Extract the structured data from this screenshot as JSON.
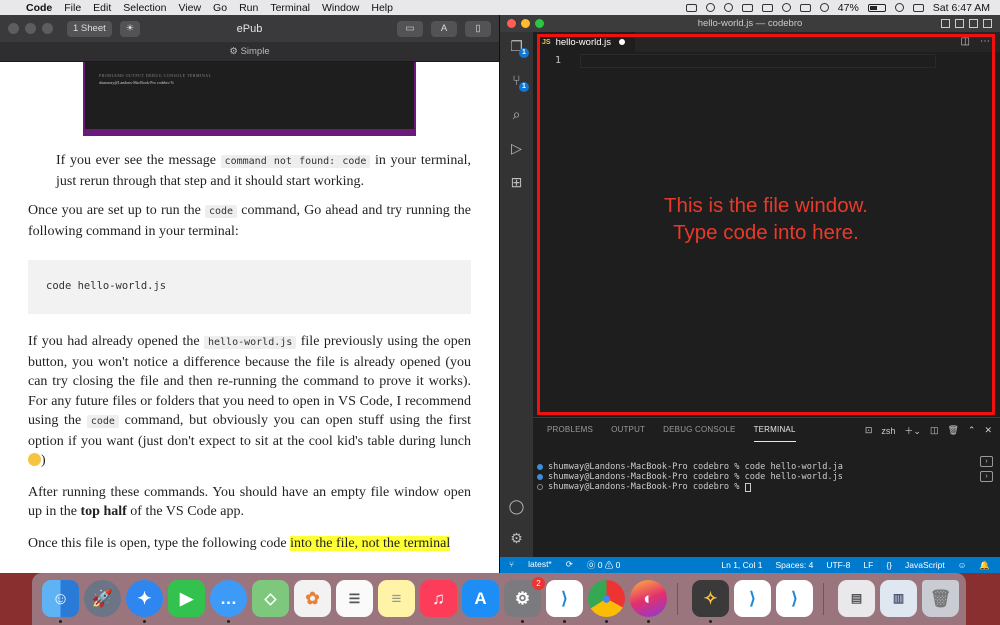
{
  "menubar": {
    "app_name": "Code",
    "items": [
      "File",
      "Edit",
      "Selection",
      "View",
      "Go",
      "Run",
      "Terminal",
      "Window",
      "Help"
    ],
    "battery": "47%",
    "battery_level": 0.47,
    "clock": "Sat 6:47 AM"
  },
  "epub": {
    "sheet_button": "1 Sheet",
    "window_title": "ePub",
    "theme_label": "Simple",
    "thumbnail": {
      "tabs": "PROBLEMS  OUTPUT  DEBUG CONSOLE  TERMINAL",
      "line": "shumway@Landons-MacBook-Pro codebro %"
    },
    "p1_pre": "If you ever see the message ",
    "p1_code": "command not found: code",
    "p1_post": " in your terminal, just rerun through that step and it should start working.",
    "p2_pre": "Once you are set up to run the ",
    "p2_code": "code",
    "p2_post": " command, Go ahead and try running the following command in your terminal:",
    "code_block": "code hello-world.js",
    "p3_a": "If you had already opened the ",
    "p3_code1": "hello-world.js",
    "p3_b": " file previously using the open button, you won't notice a difference because the file is already opened (you can try closing the file and then re-running the command to prove it works). For any future files or folders that you need to open in VS Code, I recommend using the ",
    "p3_code2": "code",
    "p3_c": " command, but obviously you can open stuff using the first option if you want (just don't expect to sit at the cool kid's table during lunch ",
    "p3_d": ")",
    "p4_pre": "After running these commands. You should have an empty file window open up in the ",
    "p4_bold": "top half",
    "p4_post": " of the VS Code app.",
    "p5_pre": "Once this file is open, type the following code ",
    "p5_hl": "into the file, not the terminal"
  },
  "vscode": {
    "window_title": "hello-world.js — codebro",
    "tab": {
      "icon_text": "JS",
      "label": "hello-world.js"
    },
    "line_number": "1",
    "annotation_line1": "This is the file window.",
    "annotation_line2": "Type code into here.",
    "activity": {
      "explorer_badge": "1",
      "scm_badge": "1"
    },
    "panel": {
      "tabs": [
        "PROBLEMS",
        "OUTPUT",
        "DEBUG CONSOLE",
        "TERMINAL"
      ],
      "active_tab": "TERMINAL",
      "shell": "zsh"
    },
    "terminal_lines": [
      "shumway@Landons-MacBook-Pro codebro % code hello-world.ja",
      "shumway@Landons-MacBook-Pro codebro % code hello-world.js",
      "shumway@Landons-MacBook-Pro codebro % "
    ],
    "status": {
      "branch": "latest*",
      "problems": "⓪ 0 ⚠ 0",
      "position": "Ln 1, Col 1",
      "spaces": "Spaces: 4",
      "encoding": "UTF-8",
      "eol": "LF",
      "language": "JavaScript"
    }
  },
  "dock": {
    "apps": [
      "finder-icon",
      "launchpad-icon",
      "safari-icon",
      "facetime-icon",
      "messages-icon",
      "maps-icon",
      "photos-icon",
      "reminders-icon",
      "notes-icon",
      "music-icon",
      "app-store-icon",
      "system-preferences-icon",
      "vscode-icon",
      "chrome-icon",
      "firefox-icon",
      "tes-icon",
      "vscode-insiders-icon",
      "vscode-icon",
      "downloads-icon",
      "documents-icon",
      "trash-icon"
    ],
    "sysprefs_badge": "2"
  },
  "colors": {
    "annotation_red": "#f01010",
    "vscode_status_blue": "#007acc",
    "highlight_yellow": "#ffff33"
  }
}
